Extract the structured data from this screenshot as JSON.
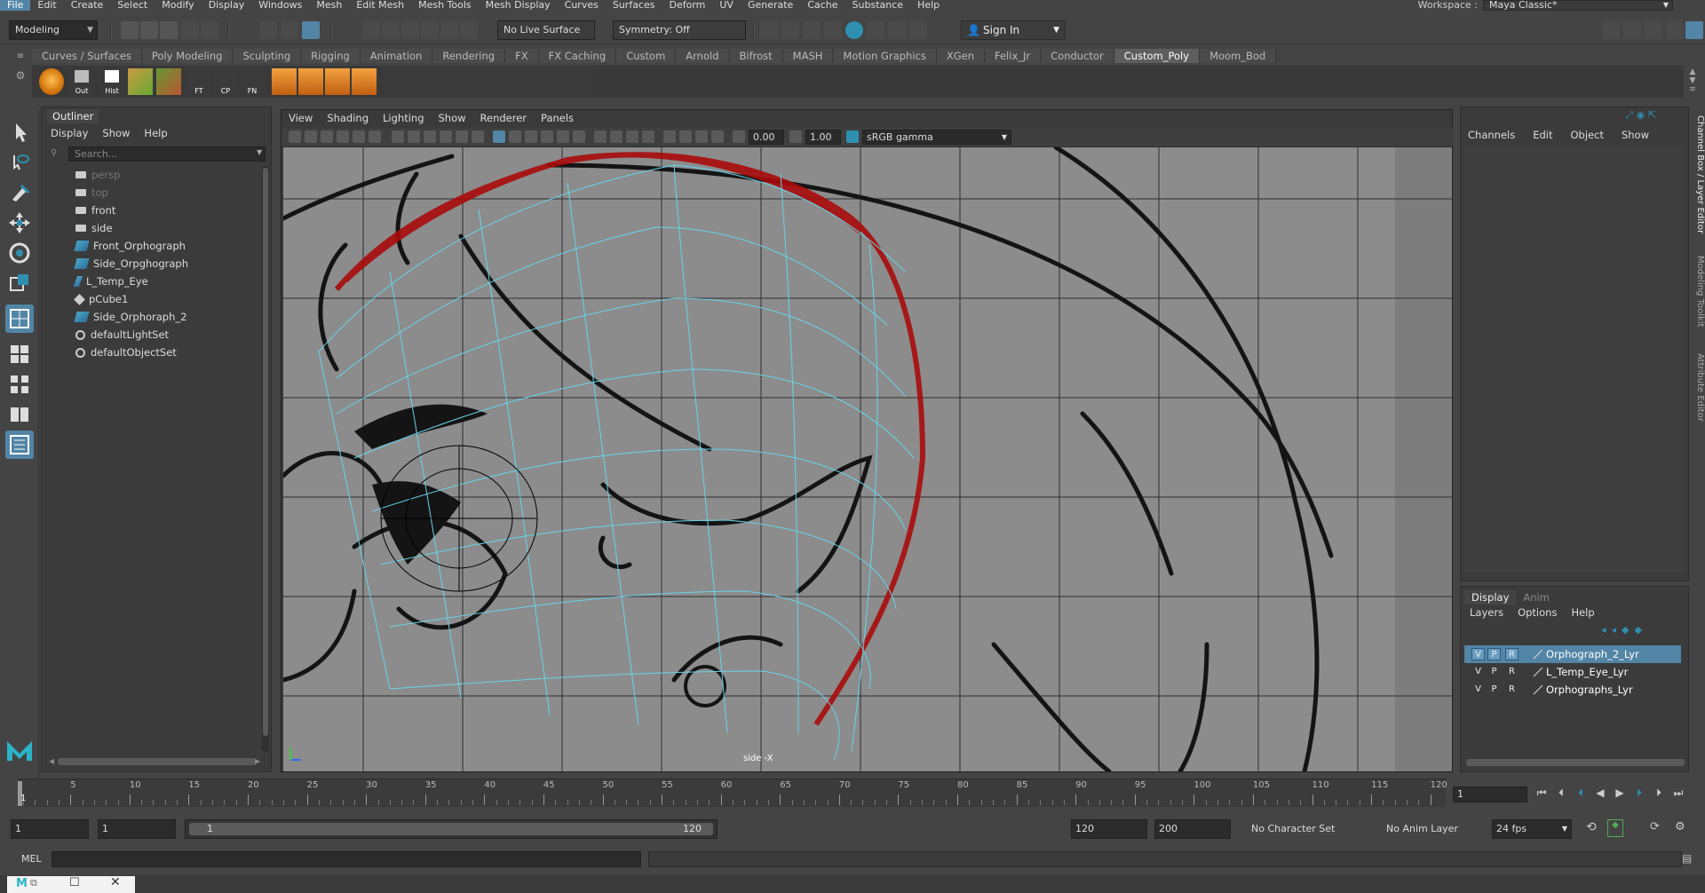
{
  "menubar": {
    "items": [
      "File",
      "Edit",
      "Create",
      "Select",
      "Modify",
      "Display",
      "Windows",
      "Mesh",
      "Edit Mesh",
      "Mesh Tools",
      "Mesh Display",
      "Curves",
      "Surfaces",
      "Deform",
      "UV",
      "Generate",
      "Cache",
      "Substance",
      "Help"
    ],
    "workspace_label": "Workspace :",
    "workspace_value": "Maya Classic*"
  },
  "statusline": {
    "mode": "Modeling",
    "live_surface": "No Live Surface",
    "symmetry": "Symmetry: Off",
    "sign_in": "Sign In"
  },
  "shelf": {
    "tabs": [
      "Curves / Surfaces",
      "Poly Modeling",
      "Sculpting",
      "Rigging",
      "Animation",
      "Rendering",
      "FX",
      "FX Caching",
      "Custom",
      "Arnold",
      "Bifrost",
      "MASH",
      "Motion Graphics",
      "XGen",
      "Felix_Jr",
      "Conductor",
      "Custom_Poly",
      "Moom_Bod"
    ],
    "active_tab": "Custom_Poly",
    "icon_captions": [
      "Out",
      "Hist",
      "FT",
      "CP",
      "FN"
    ]
  },
  "outliner": {
    "title": "Outliner",
    "menu": [
      "Display",
      "Show",
      "Help"
    ],
    "search_placeholder": "Search...",
    "items": [
      {
        "name": "persp",
        "icon": "camera-icon",
        "dim": true
      },
      {
        "name": "top",
        "icon": "camera-icon",
        "dim": true
      },
      {
        "name": "front",
        "icon": "camera-icon",
        "dim": false
      },
      {
        "name": "side",
        "icon": "camera-icon",
        "dim": false
      },
      {
        "name": "Front_Orphograph",
        "icon": "image-plane-icon",
        "dim": false
      },
      {
        "name": "Side_Orpghograph",
        "icon": "image-plane-icon",
        "dim": false
      },
      {
        "name": "L_Temp_Eye",
        "icon": "curve-icon",
        "dim": false
      },
      {
        "name": "pCube1",
        "icon": "mesh-icon",
        "dim": false
      },
      {
        "name": "Side_Orphoraph_2",
        "icon": "image-plane-icon",
        "dim": false
      },
      {
        "name": "defaultLightSet",
        "icon": "set-icon",
        "dim": false
      },
      {
        "name": "defaultObjectSet",
        "icon": "set-icon",
        "dim": false
      }
    ]
  },
  "viewport": {
    "menu": [
      "View",
      "Shading",
      "Lighting",
      "Show",
      "Renderer",
      "Panels"
    ],
    "exposure": "0.00",
    "gamma": "1.00",
    "color_space": "sRGB gamma",
    "camera_label": "side -X"
  },
  "channelbox": {
    "menu": [
      "Channels",
      "Edit",
      "Object",
      "Show"
    ]
  },
  "layers": {
    "tabs": [
      "Display",
      "Anim"
    ],
    "active_tab": "Display",
    "menu": [
      "Layers",
      "Options",
      "Help"
    ],
    "rows": [
      {
        "v": "V",
        "p": "P",
        "r": "R",
        "name": "Orphograph_2_Lyr",
        "selected": true
      },
      {
        "v": "V",
        "p": "P",
        "r": "R",
        "name": "L_Temp_Eye_Lyr",
        "selected": false
      },
      {
        "v": "V",
        "p": "P",
        "r": "R",
        "name": "Orphographs_Lyr",
        "selected": false
      }
    ]
  },
  "side_tabs": [
    "Channel Box / Layer Editor",
    "Modeling Toolkit",
    "Attribute Editor"
  ],
  "timeslider": {
    "labels": [
      "5",
      "10",
      "15",
      "20",
      "25",
      "30",
      "35",
      "40",
      "45",
      "50",
      "55",
      "60",
      "65",
      "70",
      "75",
      "80",
      "85",
      "90",
      "95",
      "100",
      "105",
      "110",
      "115",
      "120"
    ],
    "current_frame_marker": "1",
    "current_frame": "1"
  },
  "range": {
    "start": "1",
    "playback_start": "1",
    "bar_start": "1",
    "bar_end": "120",
    "playback_end": "120",
    "end": "200",
    "character_set": "No Character Set",
    "anim_layer": "No Anim Layer",
    "fps": "24 fps"
  },
  "commandline": {
    "label": "MEL"
  },
  "colors": {
    "selection": "#5285a6",
    "wireframe": "#67d4ea",
    "sketch_red": "#b01010"
  }
}
